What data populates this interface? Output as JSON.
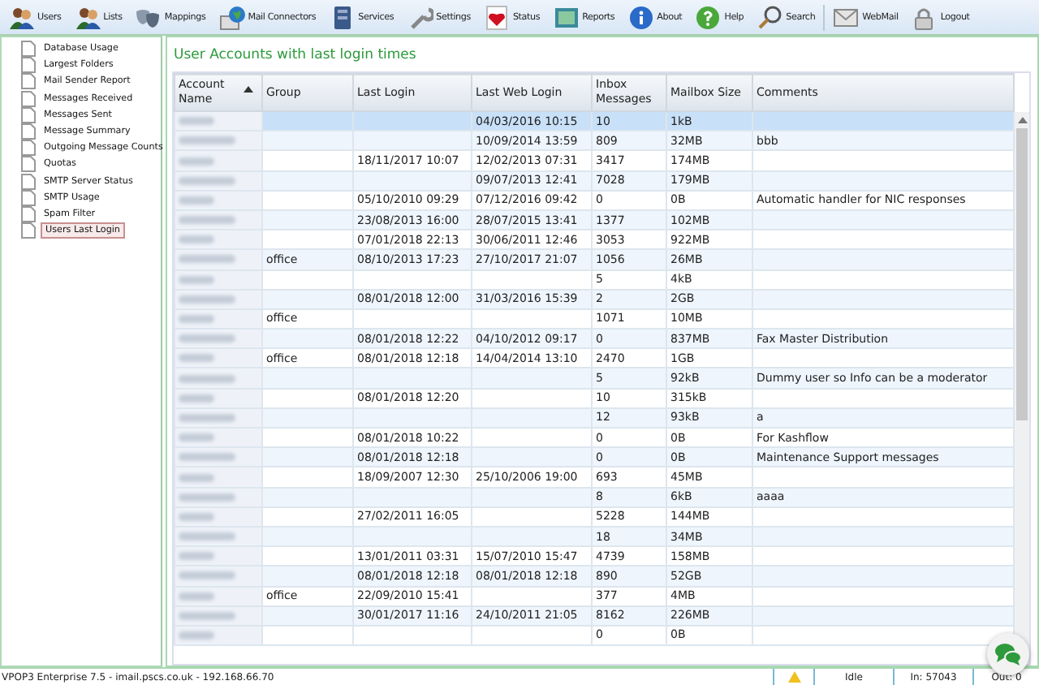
{
  "toolbar": [
    {
      "label": "Users"
    },
    {
      "label": "Lists"
    },
    {
      "label": "Mappings"
    },
    {
      "label": "Mail Connectors"
    },
    {
      "label": "Services"
    },
    {
      "label": "Settings"
    },
    {
      "label": "Status"
    },
    {
      "label": "Reports"
    },
    {
      "label": "About"
    },
    {
      "label": "Help"
    },
    {
      "label": "Search"
    },
    {
      "label": "WebMail"
    },
    {
      "label": "Logout"
    }
  ],
  "sidebar": {
    "items": [
      {
        "label": "Database Usage",
        "selected": false
      },
      {
        "label": "Largest Folders",
        "selected": false
      },
      {
        "label": "Mail Sender Report",
        "selected": false
      },
      {
        "label": "Messages Received",
        "selected": false
      },
      {
        "label": "Messages Sent",
        "selected": false
      },
      {
        "label": "Message Summary",
        "selected": false
      },
      {
        "label": "Outgoing Message Counts",
        "selected": false
      },
      {
        "label": "Quotas",
        "selected": false
      },
      {
        "label": "SMTP Server Status",
        "selected": false
      },
      {
        "label": "SMTP Usage",
        "selected": false
      },
      {
        "label": "Spam Filter",
        "selected": false
      },
      {
        "label": "Users Last Login",
        "selected": true
      }
    ]
  },
  "report": {
    "title": "User Accounts with last login times",
    "table": {
      "columns": [
        {
          "label": "Account Name",
          "sorted": true
        },
        {
          "label": "Group",
          "sorted": false
        },
        {
          "label": "Last Login",
          "sorted": false
        },
        {
          "label": "Last Web Login",
          "sorted": false
        },
        {
          "label": "Inbox Messages",
          "sorted": false
        },
        {
          "label": "Mailbox Size",
          "sorted": false
        },
        {
          "label": "Comments",
          "sorted": false
        }
      ],
      "rows": [
        {
          "selected": true,
          "cells": [
            null,
            null,
            null,
            "04/03/2016 10:15",
            "10",
            "1kB",
            null
          ]
        },
        {
          "selected": false,
          "cells": [
            null,
            null,
            null,
            "10/09/2014 13:59",
            "809",
            "32MB",
            "bbb"
          ]
        },
        {
          "selected": false,
          "cells": [
            null,
            null,
            "18/11/2017 10:07",
            "12/02/2013 07:31",
            "3417",
            "174MB",
            null
          ]
        },
        {
          "selected": false,
          "cells": [
            null,
            null,
            null,
            "09/07/2013 12:41",
            "7028",
            "179MB",
            null
          ]
        },
        {
          "selected": false,
          "cells": [
            null,
            null,
            "05/10/2010 09:29",
            "07/12/2016 09:42",
            "0",
            "0B",
            "Automatic handler for NIC responses"
          ]
        },
        {
          "selected": false,
          "cells": [
            null,
            null,
            "23/08/2013 16:00",
            "28/07/2015 13:41",
            "1377",
            "102MB",
            null
          ]
        },
        {
          "selected": false,
          "cells": [
            null,
            null,
            "07/01/2018 22:13",
            "30/06/2011 12:46",
            "3053",
            "922MB",
            null
          ]
        },
        {
          "selected": false,
          "cells": [
            null,
            "office",
            "08/10/2013 17:23",
            "27/10/2017 21:07",
            "1056",
            "26MB",
            null
          ]
        },
        {
          "selected": false,
          "cells": [
            null,
            null,
            null,
            null,
            "5",
            "4kB",
            null
          ]
        },
        {
          "selected": false,
          "cells": [
            null,
            null,
            "08/01/2018 12:00",
            "31/03/2016 15:39",
            "2",
            "2GB",
            null
          ]
        },
        {
          "selected": false,
          "cells": [
            null,
            "office",
            null,
            null,
            "1071",
            "10MB",
            null
          ]
        },
        {
          "selected": false,
          "cells": [
            null,
            null,
            "08/01/2018 12:22",
            "04/10/2012 09:17",
            "0",
            "837MB",
            "Fax Master Distribution"
          ]
        },
        {
          "selected": false,
          "cells": [
            null,
            "office",
            "08/01/2018 12:18",
            "14/04/2014 13:10",
            "2470",
            "1GB",
            null
          ]
        },
        {
          "selected": false,
          "cells": [
            null,
            null,
            null,
            null,
            "5",
            "92kB",
            "Dummy user so Info can be a moderator"
          ]
        },
        {
          "selected": false,
          "cells": [
            null,
            null,
            "08/01/2018 12:20",
            null,
            "10",
            "315kB",
            null
          ]
        },
        {
          "selected": false,
          "cells": [
            null,
            null,
            null,
            null,
            "12",
            "93kB",
            "a"
          ]
        },
        {
          "selected": false,
          "cells": [
            null,
            null,
            "08/01/2018 10:22",
            null,
            "0",
            "0B",
            "For Kashflow"
          ]
        },
        {
          "selected": false,
          "cells": [
            null,
            null,
            "08/01/2018 12:18",
            null,
            "0",
            "0B",
            "Maintenance Support messages"
          ]
        },
        {
          "selected": false,
          "cells": [
            null,
            null,
            "18/09/2007 12:30",
            "25/10/2006 19:00",
            "693",
            "45MB",
            null
          ]
        },
        {
          "selected": false,
          "cells": [
            null,
            null,
            null,
            null,
            "8",
            "6kB",
            "aaaa"
          ]
        },
        {
          "selected": false,
          "cells": [
            null,
            null,
            "27/02/2011 16:05",
            null,
            "5228",
            "144MB",
            null
          ]
        },
        {
          "selected": false,
          "cells": [
            null,
            null,
            null,
            null,
            "18",
            "34MB",
            null
          ]
        },
        {
          "selected": false,
          "cells": [
            null,
            null,
            "13/01/2011 03:31",
            "15/07/2010 15:47",
            "4739",
            "158MB",
            null
          ]
        },
        {
          "selected": false,
          "cells": [
            null,
            null,
            "08/01/2018 12:18",
            "08/01/2018 12:18",
            "890",
            "52GB",
            null
          ]
        },
        {
          "selected": false,
          "cells": [
            null,
            "office",
            "22/09/2010 15:41",
            null,
            "377",
            "4MB",
            null
          ]
        },
        {
          "selected": false,
          "cells": [
            null,
            null,
            "30/01/2017 11:16",
            "24/10/2011 21:05",
            "8162",
            "226MB",
            null
          ]
        },
        {
          "selected": false,
          "cells": [
            null,
            null,
            null,
            null,
            "0",
            "0B",
            null
          ]
        }
      ]
    }
  },
  "status_bar": {
    "server": "VPOP3 Enterprise 7.5 - imail.pscs.co.uk - 192.168.66.70",
    "warning": true,
    "state": "Idle",
    "in": "In: 57043",
    "out": "Out: 0"
  }
}
